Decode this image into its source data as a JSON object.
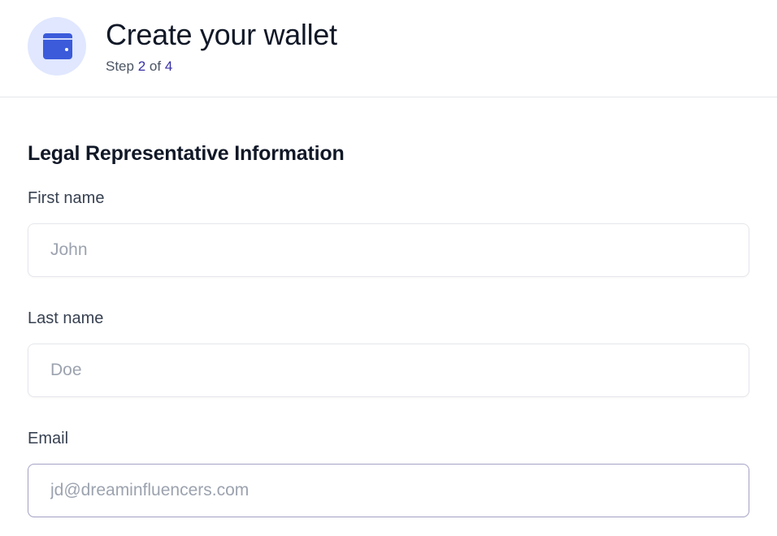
{
  "header": {
    "icon": "wallet-icon",
    "title": "Create your wallet",
    "step_prefix": "Step",
    "step_current": "2",
    "step_of": "of",
    "step_total": "4"
  },
  "form": {
    "section_title": "Legal Representative Information",
    "first_name": {
      "label": "First name",
      "value": "",
      "placeholder": "John"
    },
    "last_name": {
      "label": "Last name",
      "value": "",
      "placeholder": "Doe"
    },
    "email": {
      "label": "Email",
      "value": "",
      "placeholder": "jd@dreaminfluencers.com"
    }
  },
  "colors": {
    "accent": "#3b5bdb",
    "icon_bg": "#e0e7ff",
    "step_number": "#3730a3"
  }
}
